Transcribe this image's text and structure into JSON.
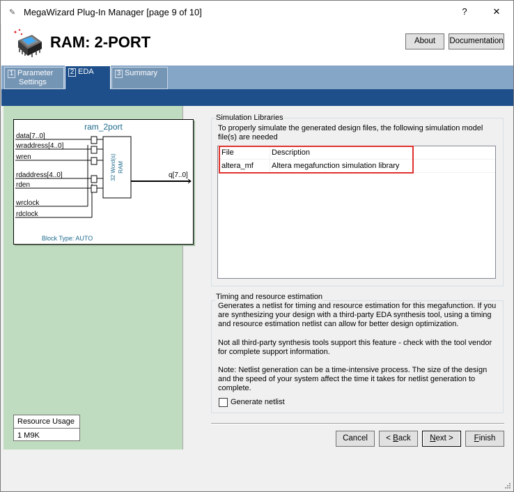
{
  "window": {
    "title": "MegaWizard Plug-In Manager [page 9 of 10]",
    "help_glyph": "?",
    "close_glyph": "✕",
    "title_icon": "✎"
  },
  "header": {
    "title": "RAM: 2-PORT",
    "about_label": "About",
    "documentation_label": "Documentation"
  },
  "tabs": [
    {
      "num": "1",
      "label_line1": "Parameter",
      "label_line2": "Settings"
    },
    {
      "num": "2",
      "label_line1": "EDA",
      "label_line2": ""
    },
    {
      "num": "3",
      "label_line1": "Summary",
      "label_line2": ""
    }
  ],
  "symbol": {
    "name": "ram_2port",
    "inputs": [
      "data[7..0]",
      "wraddress[4..0]",
      "wren",
      "rdaddress[4..0]",
      "rden",
      "wrclock",
      "rdclock"
    ],
    "output": "q[7..0]",
    "block_line1": "32 Word(s)",
    "block_line2": "RAM",
    "block_type": "Block Type: AUTO"
  },
  "resource": {
    "header": "Resource Usage",
    "value": "1 M9K"
  },
  "simulation": {
    "group_label": "Simulation Libraries",
    "desc_line1": "To properly simulate the generated design files, the following simulation model",
    "desc_line2": "file(s) are needed",
    "col_file": "File",
    "col_description": "Description",
    "rows": [
      {
        "file": "altera_mf",
        "description": "Altera megafunction simulation library"
      }
    ]
  },
  "timing": {
    "group_label": "Timing and resource estimation",
    "p1_l1": "Generates a netlist for timing and resource estimation for this megafunction. If you",
    "p1_l2": "are synthesizing your design with a third-party EDA synthesis tool, using a timing",
    "p1_l3": "and resource estimation netlist can allow for better design optimization.",
    "p2_l1": "Not all third-party synthesis tools support this feature - check with the tool vendor",
    "p2_l2": "for complete support information.",
    "p3_l1": "Note: Netlist generation can be a time-intensive process. The size of the design",
    "p3_l2": "and the speed of your system affect the time it takes for netlist generation to",
    "p3_l3": "complete.",
    "generate_label": "Generate netlist",
    "generate_checked": false
  },
  "footer": {
    "cancel": "Cancel",
    "back_prefix": "< ",
    "back_key": "B",
    "back_rest": "ack",
    "next_key": "N",
    "next_rest": "ext >",
    "finish_key": "F",
    "finish_rest": "inish"
  },
  "colors": {
    "tab_active": "#1e4f8a",
    "tab_strip": "#86a6c7",
    "left_pane": "#c0dcc0",
    "highlight": "#e0302c"
  }
}
